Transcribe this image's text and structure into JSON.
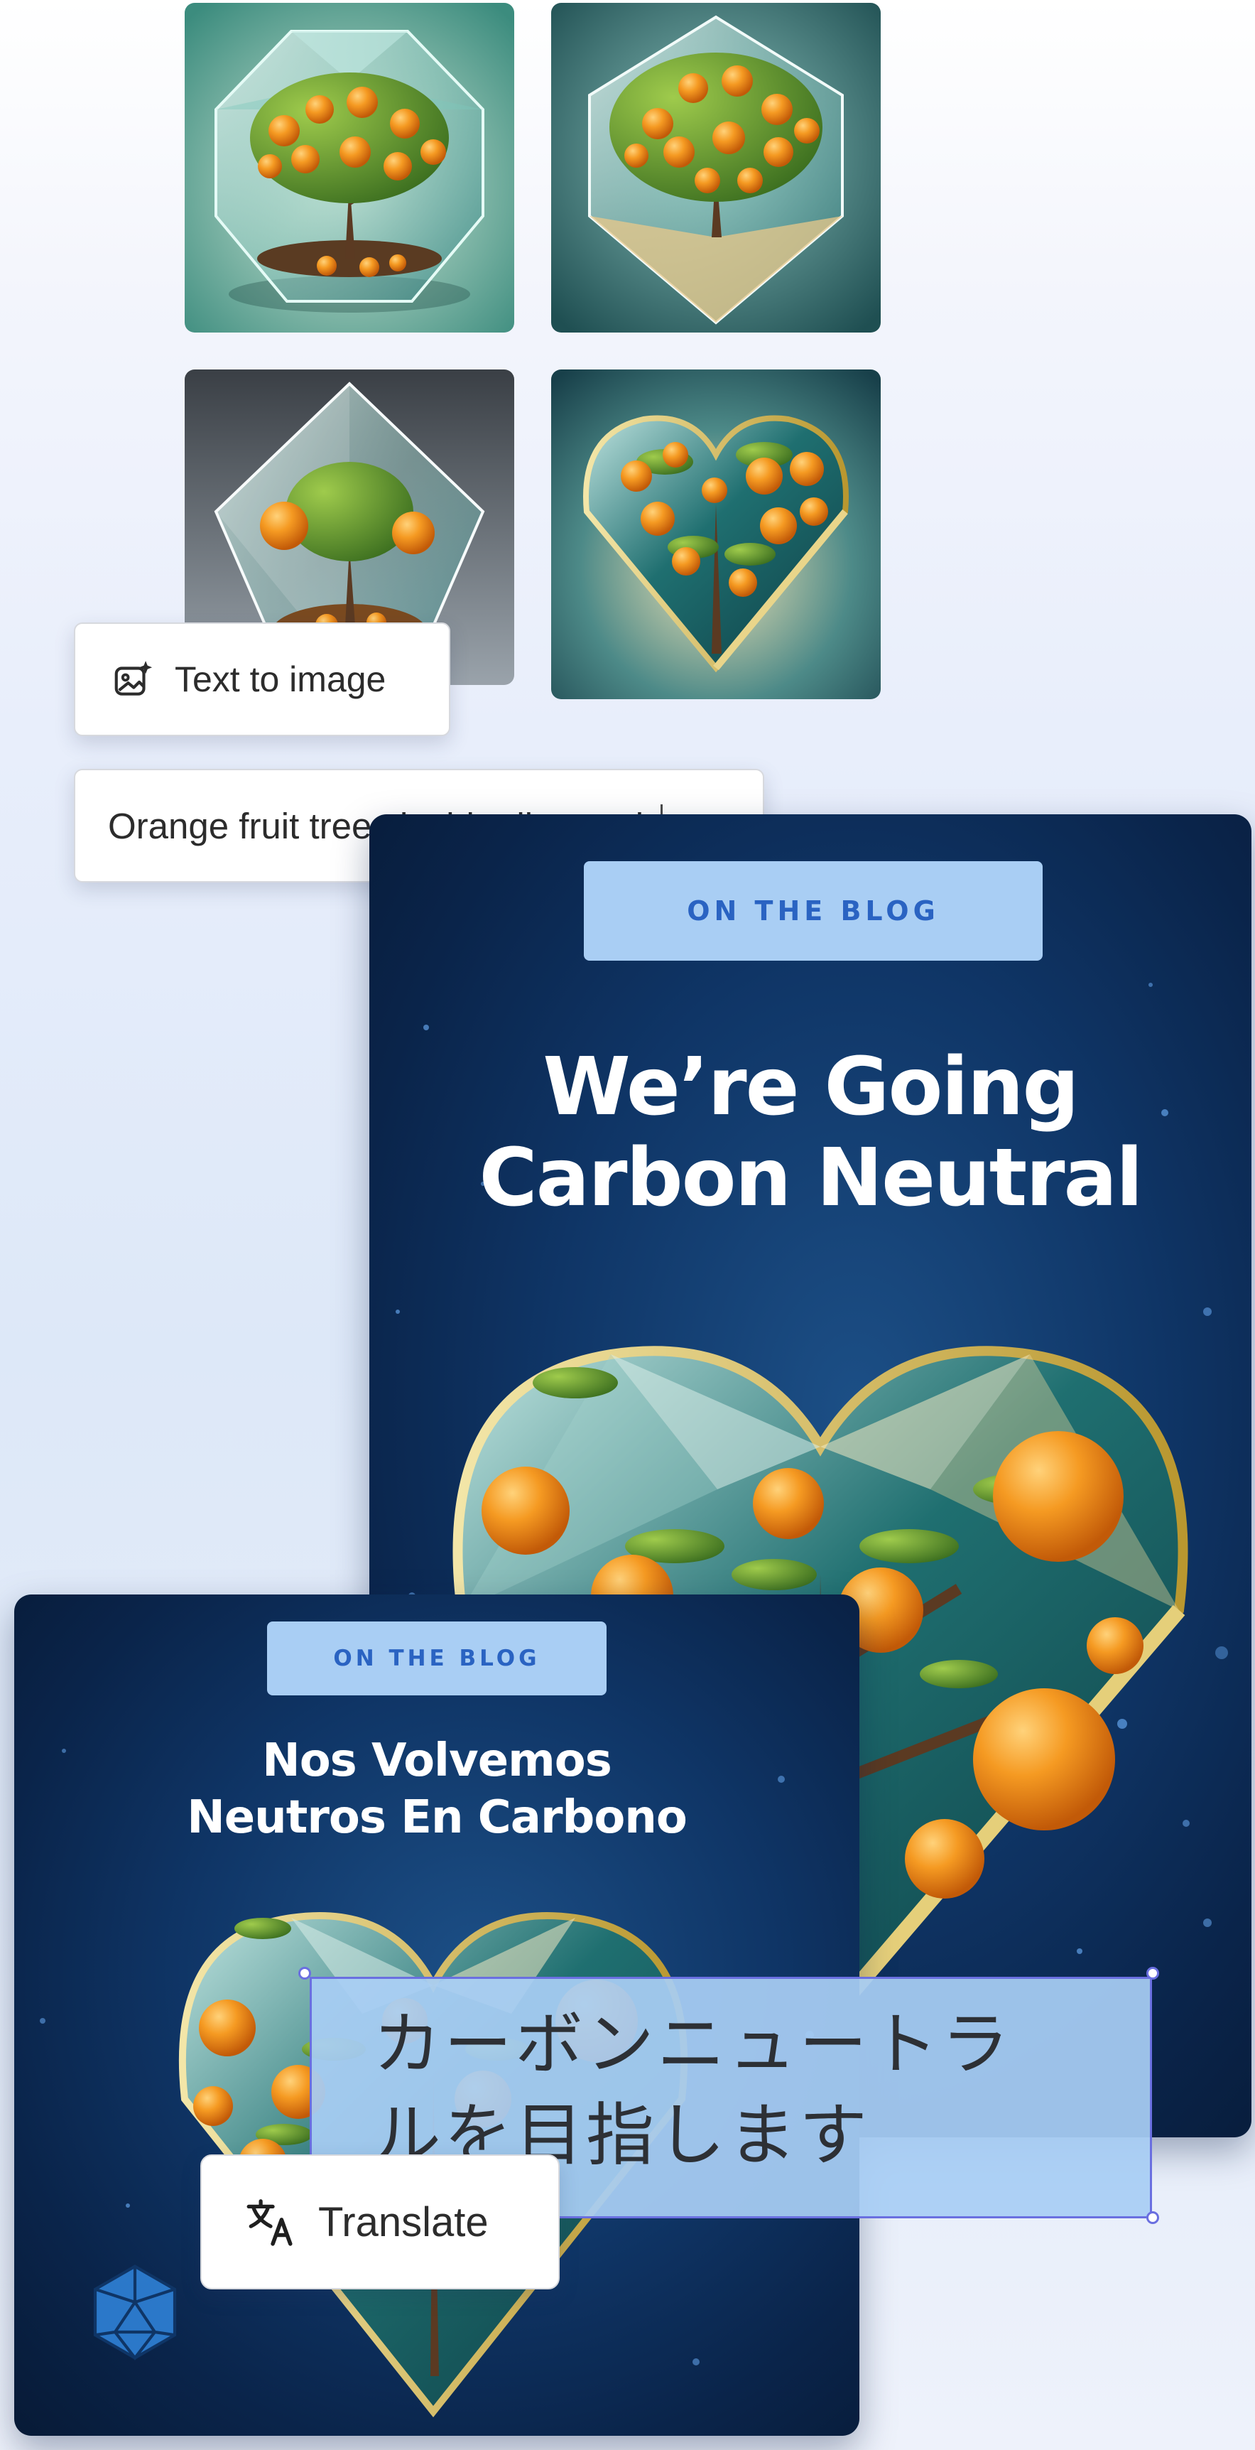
{
  "tools": {
    "text_to_image": {
      "label": "Text to image",
      "icon": "image-sparkle-icon"
    },
    "prompt": {
      "value": "Orange fruit trees inside diamond"
    },
    "translate": {
      "label": "Translate",
      "icon": "translate-icon"
    }
  },
  "thumbnails": [
    {
      "name": "orange-tree-crystal-1"
    },
    {
      "name": "orange-tree-crystal-2"
    },
    {
      "name": "orange-tree-crystal-3"
    },
    {
      "name": "orange-tree-heart-diamond"
    }
  ],
  "poster_en": {
    "badge": "ON THE BLOG",
    "headline_line1": "We’re Going",
    "headline_line2": "Carbon Neutral"
  },
  "poster_es": {
    "badge": "ON THE BLOG",
    "headline_line1": "Nos Volvemos",
    "headline_line2": "Neutros En Carbono",
    "logo_icon": "geodesic-logo-icon"
  },
  "translation_jp": {
    "line1": "カーボンニュートラ",
    "line2": "ルを目指します"
  },
  "colors": {
    "badge_bg": "#a9cef4",
    "badge_text": "#2a63c2",
    "selection": "#6a6fe0",
    "poster_bg": "#0f3566",
    "orange": "#f08a1c"
  }
}
